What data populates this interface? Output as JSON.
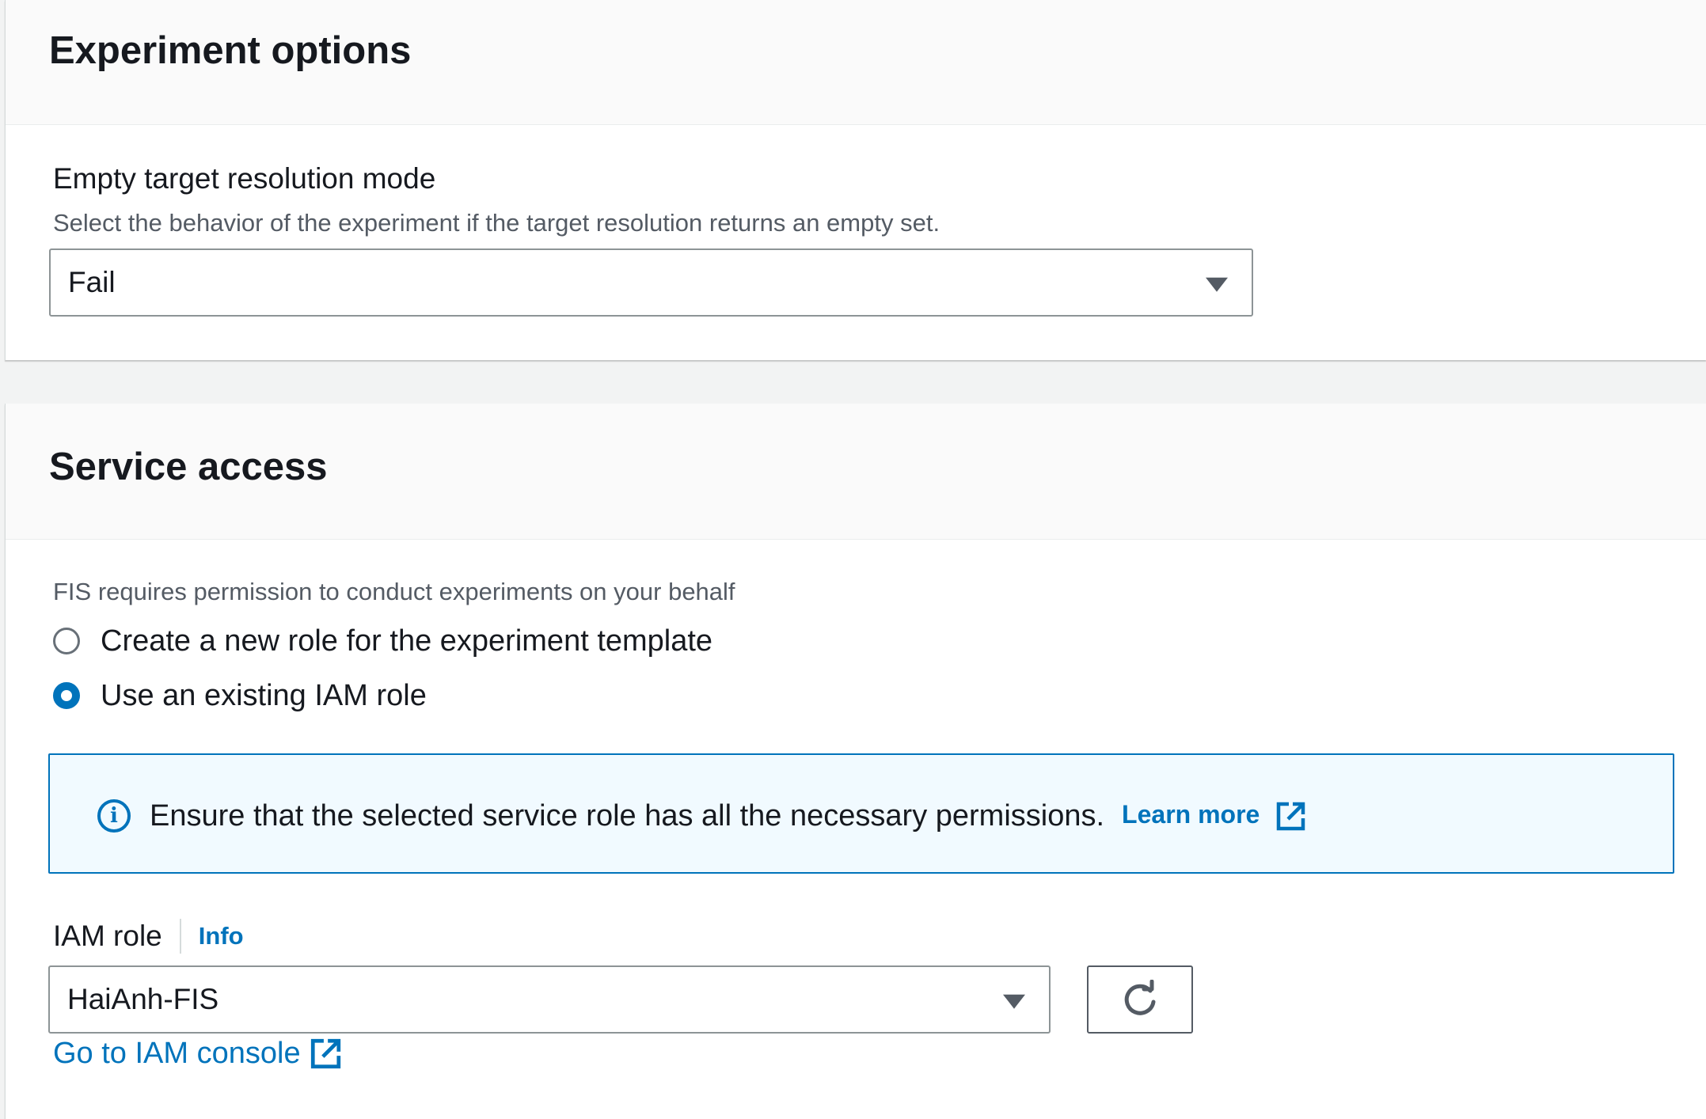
{
  "experiment_options": {
    "title": "Experiment options",
    "empty_target": {
      "label": "Empty target resolution mode",
      "description": "Select the behavior of the experiment if the target resolution returns an empty set.",
      "selected": "Fail"
    }
  },
  "service_access": {
    "title": "Service access",
    "description": "FIS requires permission to conduct experiments on your behalf",
    "radio_options": [
      {
        "label": "Create a new role for the experiment template",
        "checked": false
      },
      {
        "label": "Use an existing IAM role",
        "checked": true
      }
    ],
    "alert": {
      "text": "Ensure that the selected service role has all the necessary permissions.",
      "link": "Learn more"
    },
    "iam_role": {
      "label": "IAM role",
      "info": "Info",
      "selected": "HaiAnh-FIS"
    },
    "console_link": "Go to IAM console"
  },
  "icons": {
    "dropdown": "caret-down-icon",
    "info": "info-icon",
    "external": "external-link-icon",
    "refresh": "refresh-icon"
  },
  "colors": {
    "link": "#0073bb",
    "alert_background": "#f1faff",
    "alert_border": "#0073bb",
    "text": "#16191f",
    "muted": "#545b64"
  }
}
